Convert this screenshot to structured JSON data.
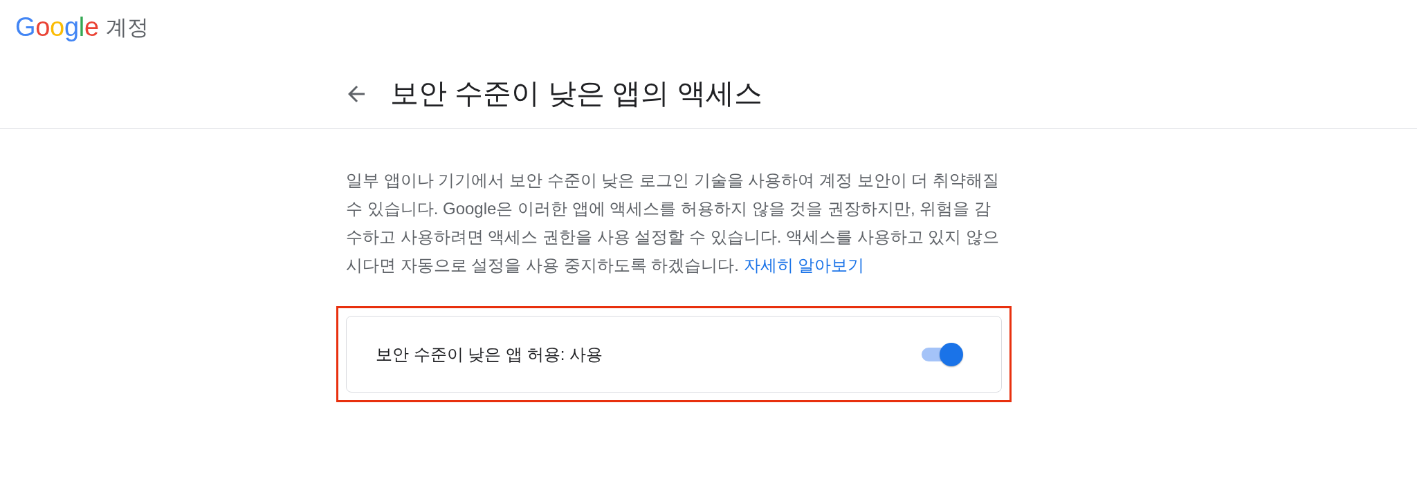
{
  "header": {
    "logo": "Google",
    "product": "계정"
  },
  "page": {
    "title": "보안 수준이 낮은 앱의 액세스"
  },
  "description": {
    "text": "일부 앱이나 기기에서 보안 수준이 낮은 로그인 기술을 사용하여 계정 보안이 더 취약해질 수 있습니다. Google은 이러한 앱에 액세스를 허용하지 않을 것을 권장하지만, 위험을 감수하고 사용하려면 액세스 권한을 사용 설정할 수 있습니다. 액세스를 사용하고 있지 않으시다면 자동으로 설정을 사용 중지하도록 하겠습니다.",
    "link": "자세히 알아보기"
  },
  "setting": {
    "label": "보안 수준이 낮은 앱 허용: 사용",
    "on": true,
    "highlighted": true
  }
}
